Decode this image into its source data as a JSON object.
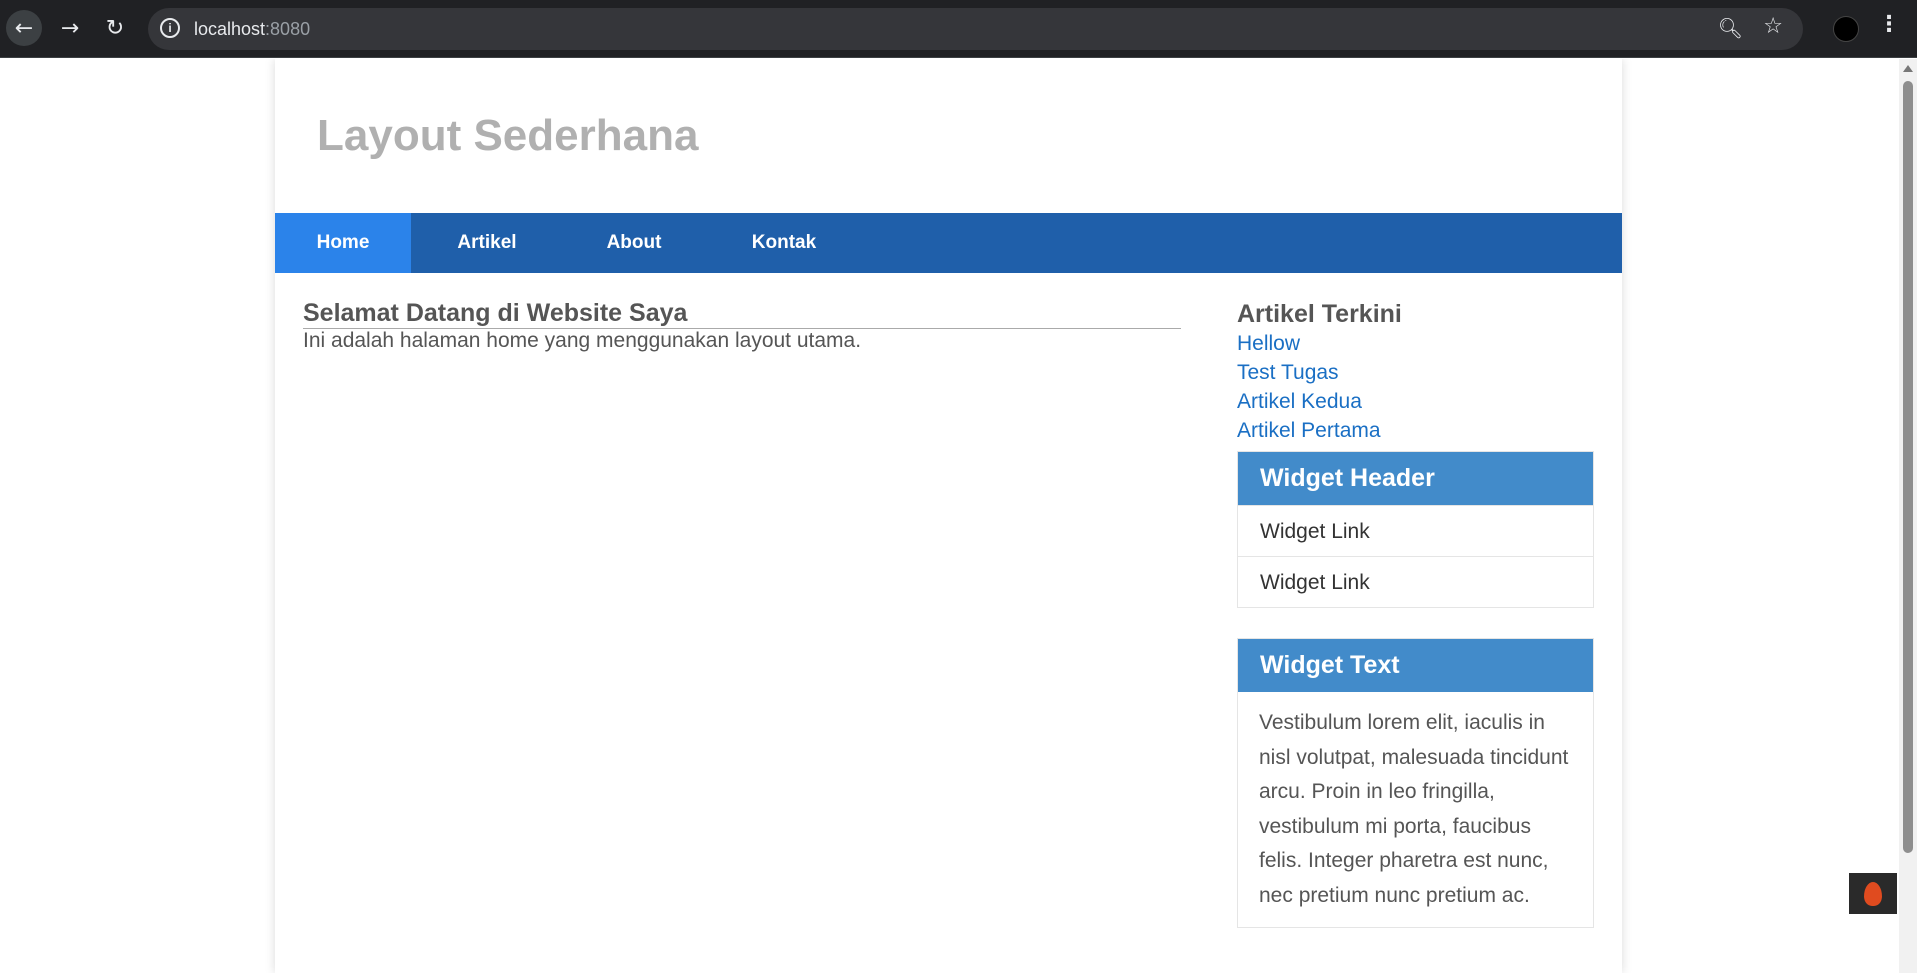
{
  "browser": {
    "url_host": "localhost",
    "url_port": ":8080",
    "back_icon": "arrow-left-icon",
    "forward_icon": "arrow-right-icon",
    "reload_icon": "reload-icon",
    "info_icon": "info-icon",
    "zoom_icon": "zoom-icon",
    "star_icon": "star-icon",
    "menu_icon": "kebab-menu-icon"
  },
  "site": {
    "title": "Layout Sederhana"
  },
  "nav": {
    "items": [
      {
        "label": "Home",
        "active": true
      },
      {
        "label": "Artikel",
        "active": false
      },
      {
        "label": "About",
        "active": false
      },
      {
        "label": "Kontak",
        "active": false
      }
    ]
  },
  "main": {
    "heading": "Selamat Datang di Website Saya",
    "body": "Ini adalah halaman home yang menggunakan layout utama."
  },
  "sidebar": {
    "recent_title": "Artikel Terkini",
    "recent_articles": [
      "Hellow",
      "Test Tugas",
      "Artikel Kedua",
      "Artikel Pertama"
    ],
    "widget_links": {
      "header": "Widget Header",
      "links": [
        "Widget Link",
        "Widget Link"
      ]
    },
    "widget_text": {
      "header": "Widget Text",
      "body": "Vestibulum lorem elit, iaculis in nisl volutpat, malesuada tincidunt arcu. Proin in leo fringilla, vestibulum mi porta, faucibus felis. Integer pharetra est nunc, nec pretium nunc pretium ac."
    }
  },
  "colors": {
    "nav_bg": "#1f5faa",
    "nav_active": "#2b83ea",
    "widget_header": "#428bca",
    "link": "#1a6fc4"
  }
}
